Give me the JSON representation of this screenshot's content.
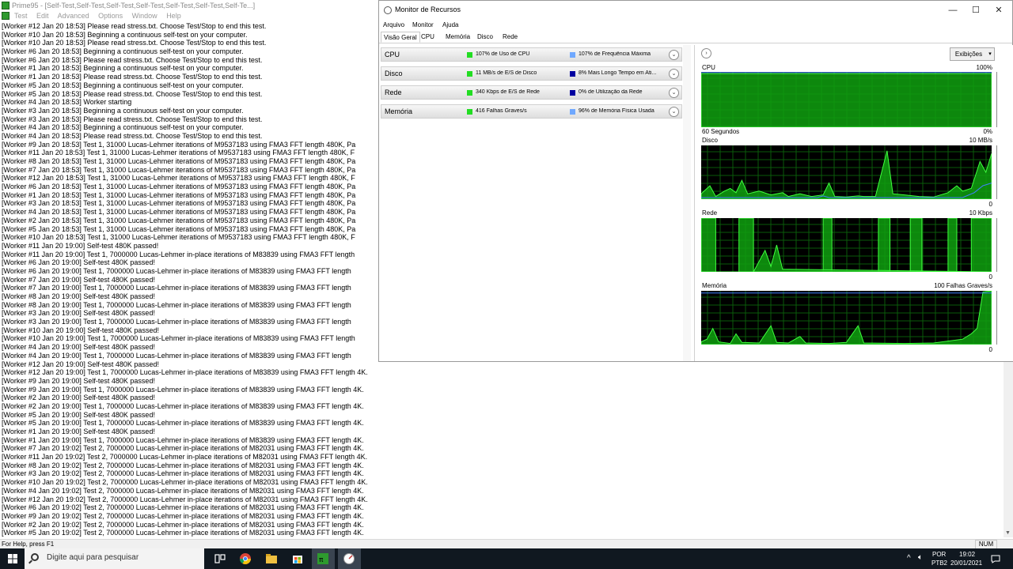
{
  "prime95": {
    "title": "Prime95 - [Self-Test,Self-Test,Self-Test,Self-Test,Self-Test,Self-Test,Self-Te...]",
    "menu": [
      "Test",
      "Edit",
      "Advanced",
      "Options",
      "Window",
      "Help"
    ],
    "log": [
      "[Worker #12 Jan 20 18:53] Please read stress.txt.  Choose Test/Stop to end this test.",
      "[Worker #10 Jan 20 18:53] Beginning a continuous self-test on your computer.",
      "[Worker #10 Jan 20 18:53] Please read stress.txt.  Choose Test/Stop to end this test.",
      "[Worker #6 Jan 20 18:53] Beginning a continuous self-test on your computer.",
      "[Worker #6 Jan 20 18:53] Please read stress.txt.  Choose Test/Stop to end this test.",
      "[Worker #1 Jan 20 18:53] Beginning a continuous self-test on your computer.",
      "[Worker #1 Jan 20 18:53] Please read stress.txt.  Choose Test/Stop to end this test.",
      "[Worker #5 Jan 20 18:53] Beginning a continuous self-test on your computer.",
      "[Worker #5 Jan 20 18:53] Please read stress.txt.  Choose Test/Stop to end this test.",
      "[Worker #4 Jan 20 18:53] Worker starting",
      "[Worker #3 Jan 20 18:53] Beginning a continuous self-test on your computer.",
      "[Worker #3 Jan 20 18:53] Please read stress.txt.  Choose Test/Stop to end this test.",
      "[Worker #4 Jan 20 18:53] Beginning a continuous self-test on your computer.",
      "[Worker #4 Jan 20 18:53] Please read stress.txt.  Choose Test/Stop to end this test.",
      "[Worker #9 Jan 20 18:53] Test 1, 31000 Lucas-Lehmer iterations of M9537183 using FMA3 FFT length 480K, Pa",
      "[Worker #11 Jan 20 18:53] Test 1, 31000 Lucas-Lehmer iterations of M9537183 using FMA3 FFT length 480K, F",
      "[Worker #8 Jan 20 18:53] Test 1, 31000 Lucas-Lehmer iterations of M9537183 using FMA3 FFT length 480K, Pa",
      "[Worker #7 Jan 20 18:53] Test 1, 31000 Lucas-Lehmer iterations of M9537183 using FMA3 FFT length 480K, Pa",
      "[Worker #12 Jan 20 18:53] Test 1, 31000 Lucas-Lehmer iterations of M9537183 using FMA3 FFT length 480K, F",
      "[Worker #6 Jan 20 18:53] Test 1, 31000 Lucas-Lehmer iterations of M9537183 using FMA3 FFT length 480K, Pa",
      "[Worker #1 Jan 20 18:53] Test 1, 31000 Lucas-Lehmer iterations of M9537183 using FMA3 FFT length 480K, Pa",
      "[Worker #3 Jan 20 18:53] Test 1, 31000 Lucas-Lehmer iterations of M9537183 using FMA3 FFT length 480K, Pa",
      "[Worker #4 Jan 20 18:53] Test 1, 31000 Lucas-Lehmer iterations of M9537183 using FMA3 FFT length 480K, Pa",
      "[Worker #2 Jan 20 18:53] Test 1, 31000 Lucas-Lehmer iterations of M9537183 using FMA3 FFT length 480K, Pa",
      "[Worker #5 Jan 20 18:53] Test 1, 31000 Lucas-Lehmer iterations of M9537183 using FMA3 FFT length 480K, Pa",
      "[Worker #10 Jan 20 18:53] Test 1, 31000 Lucas-Lehmer iterations of M9537183 using FMA3 FFT length 480K, F",
      "[Worker #11 Jan 20 19:00] Self-test 480K passed!",
      "[Worker #11 Jan 20 19:00] Test 1, 7000000 Lucas-Lehmer in-place iterations of M83839 using FMA3 FFT length",
      "[Worker #6 Jan 20 19:00] Self-test 480K passed!",
      "[Worker #6 Jan 20 19:00] Test 1, 7000000 Lucas-Lehmer in-place iterations of M83839 using FMA3 FFT length",
      "[Worker #7 Jan 20 19:00] Self-test 480K passed!",
      "[Worker #7 Jan 20 19:00] Test 1, 7000000 Lucas-Lehmer in-place iterations of M83839 using FMA3 FFT length",
      "[Worker #8 Jan 20 19:00] Self-test 480K passed!",
      "[Worker #8 Jan 20 19:00] Test 1, 7000000 Lucas-Lehmer in-place iterations of M83839 using FMA3 FFT length",
      "[Worker #3 Jan 20 19:00] Self-test 480K passed!",
      "[Worker #3 Jan 20 19:00] Test 1, 7000000 Lucas-Lehmer in-place iterations of M83839 using FMA3 FFT length",
      "[Worker #10 Jan 20 19:00] Self-test 480K passed!",
      "[Worker #10 Jan 20 19:00] Test 1, 7000000 Lucas-Lehmer in-place iterations of M83839 using FMA3 FFT length",
      "[Worker #4 Jan 20 19:00] Self-test 480K passed!",
      "[Worker #4 Jan 20 19:00] Test 1, 7000000 Lucas-Lehmer in-place iterations of M83839 using FMA3 FFT length",
      "[Worker #12 Jan 20 19:00] Self-test 480K passed!",
      "[Worker #12 Jan 20 19:00] Test 1, 7000000 Lucas-Lehmer in-place iterations of M83839 using FMA3 FFT length 4K.",
      "[Worker #9 Jan 20 19:00] Self-test 480K passed!",
      "[Worker #9 Jan 20 19:00] Test 1, 7000000 Lucas-Lehmer in-place iterations of M83839 using FMA3 FFT length 4K.",
      "[Worker #2 Jan 20 19:00] Self-test 480K passed!",
      "[Worker #2 Jan 20 19:00] Test 1, 7000000 Lucas-Lehmer in-place iterations of M83839 using FMA3 FFT length 4K.",
      "[Worker #5 Jan 20 19:00] Self-test 480K passed!",
      "[Worker #5 Jan 20 19:00] Test 1, 7000000 Lucas-Lehmer in-place iterations of M83839 using FMA3 FFT length 4K.",
      "[Worker #1 Jan 20 19:00] Self-test 480K passed!",
      "[Worker #1 Jan 20 19:00] Test 1, 7000000 Lucas-Lehmer in-place iterations of M83839 using FMA3 FFT length 4K.",
      "[Worker #7 Jan 20 19:02] Test 2, 7000000 Lucas-Lehmer in-place iterations of M82031 using FMA3 FFT length 4K.",
      "[Worker #11 Jan 20 19:02] Test 2, 7000000 Lucas-Lehmer in-place iterations of M82031 using FMA3 FFT length 4K.",
      "[Worker #8 Jan 20 19:02] Test 2, 7000000 Lucas-Lehmer in-place iterations of M82031 using FMA3 FFT length 4K.",
      "[Worker #3 Jan 20 19:02] Test 2, 7000000 Lucas-Lehmer in-place iterations of M82031 using FMA3 FFT length 4K.",
      "[Worker #10 Jan 20 19:02] Test 2, 7000000 Lucas-Lehmer in-place iterations of M82031 using FMA3 FFT length 4K.",
      "[Worker #4 Jan 20 19:02] Test 2, 7000000 Lucas-Lehmer in-place iterations of M82031 using FMA3 FFT length 4K.",
      "[Worker #12 Jan 20 19:02] Test 2, 7000000 Lucas-Lehmer in-place iterations of M82031 using FMA3 FFT length 4K.",
      "[Worker #6 Jan 20 19:02] Test 2, 7000000 Lucas-Lehmer in-place iterations of M82031 using FMA3 FFT length 4K.",
      "[Worker #9 Jan 20 19:02] Test 2, 7000000 Lucas-Lehmer in-place iterations of M82031 using FMA3 FFT length 4K.",
      "[Worker #2 Jan 20 19:02] Test 2, 7000000 Lucas-Lehmer in-place iterations of M82031 using FMA3 FFT length 4K.",
      "[Worker #5 Jan 20 19:02] Test 2, 7000000 Lucas-Lehmer in-place iterations of M82031 using FMA3 FFT length 4K."
    ],
    "status_help": "For Help, press F1",
    "status_num": "NUM"
  },
  "resmon": {
    "title": "Monitor de Recursos",
    "menu": [
      "Arquivo",
      "Monitor",
      "Ajuda"
    ],
    "tabs": [
      "Visão Geral",
      "CPU",
      "Memória",
      "Disco",
      "Rede"
    ],
    "active_tab": "Visão Geral",
    "sections": [
      {
        "name": "CPU",
        "stat1": "107% de Uso de CPU",
        "color1": "#22dd22",
        "stat2": "107% de Frequência Máxima",
        "color2": "#6fa8ff"
      },
      {
        "name": "Disco",
        "stat1": "11 MB/s de E/S de Disco",
        "color1": "#22dd22",
        "stat2": "8% Mais Longo Tempo em Ati...",
        "color2": "#0000a0"
      },
      {
        "name": "Rede",
        "stat1": "340 Kbps de E/S de Rede",
        "color1": "#22dd22",
        "stat2": "0% de Utilização da Rede",
        "color2": "#0000a0"
      },
      {
        "name": "Memória",
        "stat1": "416 Falhas Graves/s",
        "color1": "#22dd22",
        "stat2": "96% de Memória Física Usada",
        "color2": "#6fa8ff"
      }
    ],
    "views_button": "Exibições",
    "graphs": {
      "cpu": {
        "label": "CPU",
        "max": "100%",
        "min": "0%",
        "time": "60 Segundos"
      },
      "disk": {
        "label": "Disco",
        "max": "10 MB/s",
        "min": "0"
      },
      "net": {
        "label": "Rede",
        "max": "10 Kbps",
        "min": "0"
      },
      "mem": {
        "label": "Memória",
        "max": "100 Falhas Graves/s",
        "min": "0"
      }
    },
    "colors": {
      "graph_fill": "#0fa00f",
      "graph_line": "#3fff3f",
      "graph_bg": "#000000",
      "series2": "#4080ff"
    }
  },
  "taskbar": {
    "search_placeholder": "Digite aqui para pesquisar",
    "lang1": "POR",
    "lang2": "PTB2",
    "time": "19:02",
    "date": "20/01/2021"
  }
}
